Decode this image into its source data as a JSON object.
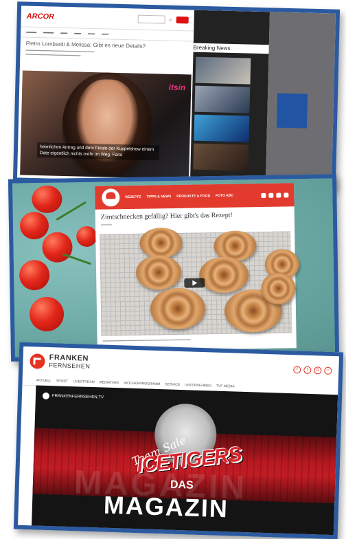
{
  "card1": {
    "logo": "ARCOR",
    "headline": "Pietro Lombardi & Melissa: Gibt es neue Details?",
    "brand": "itsin",
    "caption": "heimlichen Antrag und dem Finale der Kuppelshow einem Date eigentlich nichts mehr im Weg. Fans",
    "sidebar_title": "Breaking News",
    "colors": {
      "accent": "#d11111",
      "frame": "#2c5aa0"
    }
  },
  "card2": {
    "nav": [
      "REZEPTE",
      "TIPPS & NEWS",
      "PRODUKTE & FOOD",
      "FOTO ABC"
    ],
    "headline": "Zimtschnecken gefällig? Hier gibt's das Rezept!",
    "colors": {
      "accent": "#e23b2e"
    }
  },
  "card3": {
    "logo_line1": "FRANKEN",
    "logo_line2": "FERNSEHEN",
    "nav": [
      "AKTUELL",
      "SPORT",
      "LIVESTREAM",
      "MEDIATHEK",
      "WOCHENPROGRAMM",
      "SERVICE",
      "UNTERNEHMEN",
      "TVF MEDIA"
    ],
    "channel": "FRANKENFERNSEHEN.TV",
    "script_text": "Team Sale",
    "ice": "ICETIGERS",
    "das": "DAS",
    "magazin": "MAGAZIN",
    "colors": {
      "accent": "#e53323"
    }
  }
}
